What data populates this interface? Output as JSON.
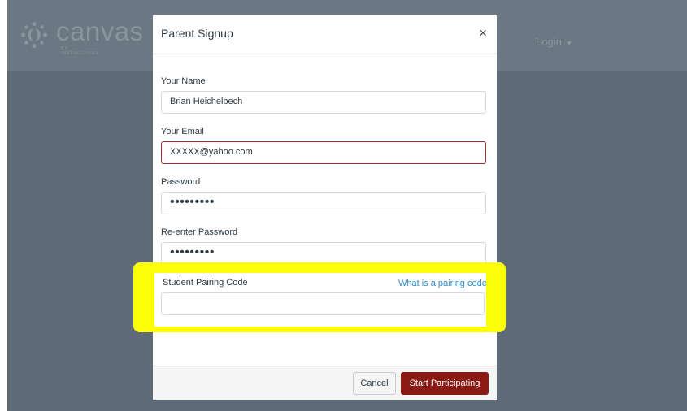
{
  "header": {
    "logo_text": "canvas",
    "logo_subtext": "BY INSTRUCTURE",
    "login_label": "Login",
    "login_caret": "▼"
  },
  "modal": {
    "title": "Parent Signup",
    "close_glyph": "×",
    "fields": {
      "name": {
        "label": "Your Name",
        "value": "Brian Heichelbech"
      },
      "email": {
        "label": "Your Email",
        "value": "XXXXX@yahoo.com"
      },
      "password": {
        "label": "Password",
        "value": "•••••••••"
      },
      "reenter_password": {
        "label": "Re-enter Password",
        "value": "•••••••••"
      },
      "pairing_code": {
        "label": "Student Pairing Code",
        "value": "",
        "help_link": "What is a pairing code?"
      }
    },
    "footer": {
      "cancel_label": "Cancel",
      "submit_label": "Start Participating"
    }
  },
  "colors": {
    "brand": "#8b1a14",
    "highlight": "#fcfd06",
    "link": "#2f8ecd",
    "error_border": "#a12a2a",
    "overlay": "#5e6a75"
  },
  "icons": [
    "canvas-logo-icon",
    "close-icon",
    "caret-down-icon"
  ]
}
